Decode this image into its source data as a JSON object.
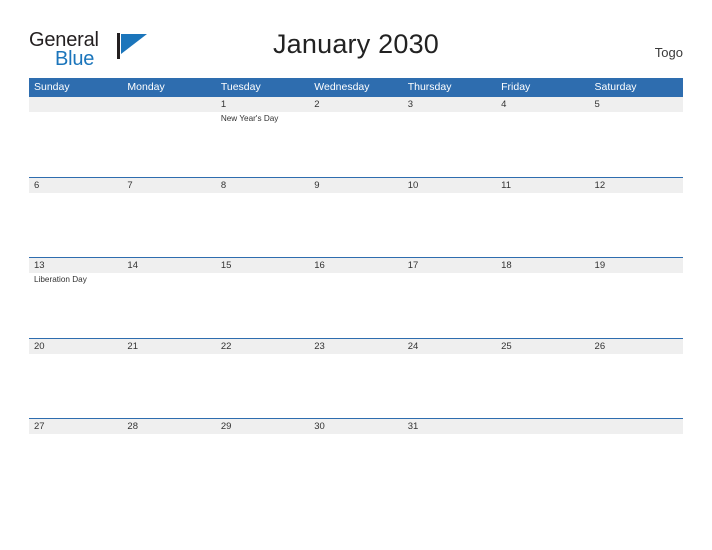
{
  "brand": {
    "word_one": "General",
    "word_two": "Blue",
    "mark": "triangle-flag-logo"
  },
  "header": {
    "title": "January 2030",
    "region": "Togo"
  },
  "calendar": {
    "weekday_headers": [
      "Sunday",
      "Monday",
      "Tuesday",
      "Wednesday",
      "Thursday",
      "Friday",
      "Saturday"
    ],
    "accent_color": "#2e6daf",
    "band_color": "#efefef",
    "weeks": [
      [
        {
          "day": "",
          "event": ""
        },
        {
          "day": "",
          "event": ""
        },
        {
          "day": "1",
          "event": "New Year's Day"
        },
        {
          "day": "2",
          "event": ""
        },
        {
          "day": "3",
          "event": ""
        },
        {
          "day": "4",
          "event": ""
        },
        {
          "day": "5",
          "event": ""
        }
      ],
      [
        {
          "day": "6",
          "event": ""
        },
        {
          "day": "7",
          "event": ""
        },
        {
          "day": "8",
          "event": ""
        },
        {
          "day": "9",
          "event": ""
        },
        {
          "day": "10",
          "event": ""
        },
        {
          "day": "11",
          "event": ""
        },
        {
          "day": "12",
          "event": ""
        }
      ],
      [
        {
          "day": "13",
          "event": "Liberation Day"
        },
        {
          "day": "14",
          "event": ""
        },
        {
          "day": "15",
          "event": ""
        },
        {
          "day": "16",
          "event": ""
        },
        {
          "day": "17",
          "event": ""
        },
        {
          "day": "18",
          "event": ""
        },
        {
          "day": "19",
          "event": ""
        }
      ],
      [
        {
          "day": "20",
          "event": ""
        },
        {
          "day": "21",
          "event": ""
        },
        {
          "day": "22",
          "event": ""
        },
        {
          "day": "23",
          "event": ""
        },
        {
          "day": "24",
          "event": ""
        },
        {
          "day": "25",
          "event": ""
        },
        {
          "day": "26",
          "event": ""
        }
      ],
      [
        {
          "day": "27",
          "event": ""
        },
        {
          "day": "28",
          "event": ""
        },
        {
          "day": "29",
          "event": ""
        },
        {
          "day": "30",
          "event": ""
        },
        {
          "day": "31",
          "event": ""
        },
        {
          "day": "",
          "event": ""
        },
        {
          "day": "",
          "event": ""
        }
      ]
    ]
  }
}
